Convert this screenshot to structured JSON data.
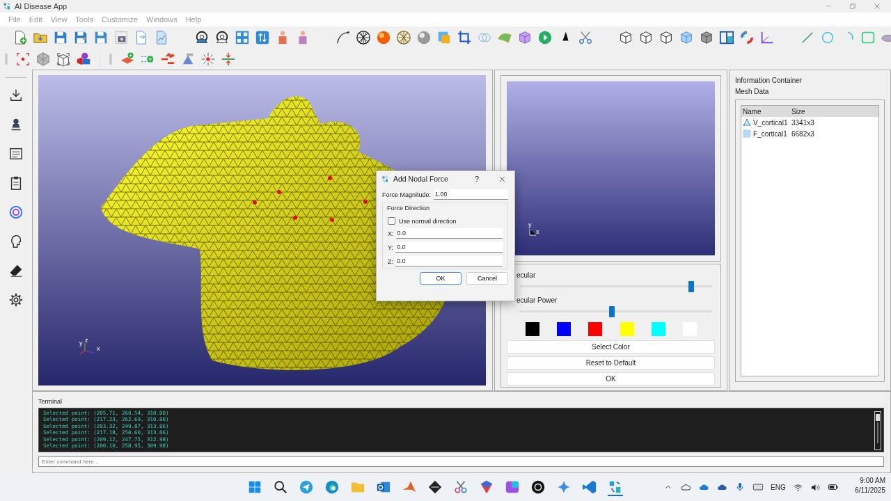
{
  "window": {
    "title": "AI Disease App"
  },
  "menu": [
    "File",
    "Edit",
    "View",
    "Tools",
    "Customize",
    "Windows",
    "Help"
  ],
  "viewport": {
    "axis_labels": [
      "y",
      "z",
      "x"
    ]
  },
  "preview": {
    "axis_labels": [
      "y",
      "x"
    ]
  },
  "lighting": {
    "sliders": [
      {
        "label": "ecular",
        "level": 0.89
      },
      {
        "label": "ecular Power",
        "level": 0.48
      }
    ],
    "swatches": [
      {
        "color": "#000000"
      },
      {
        "color": "#0000ff"
      },
      {
        "color": "#ff0000"
      },
      {
        "color": "#ffff00"
      },
      {
        "color": "#00ffff"
      },
      {
        "color": "#ffffff"
      }
    ],
    "buttons": [
      "Select Color",
      "Reset to Default",
      "OK"
    ]
  },
  "info": {
    "title": "Information Container",
    "section": "Mesh Data",
    "columns": [
      "Name",
      "Size"
    ],
    "rows": [
      {
        "kind": "vertices",
        "name": "V_cortical1",
        "size": "3341x3"
      },
      {
        "kind": "faces",
        "name": "F_cortical1",
        "size": "6682x3"
      }
    ]
  },
  "terminal": {
    "title": "Terminal",
    "lines": [
      "Selected point: (205.71, 260.54, 310.00)",
      "Selected point: (217.23, 262.69, 310.00)",
      "Selected point: (203.32, 249.87, 313.06)",
      "Selected point: (217.18, 250.60, 313.06)",
      "Selected point: (209.12, 247.75, 312.98)",
      "Selected point: (200.10, 258.95, 309.98)"
    ],
    "command_placeholder": "Enter command here..."
  },
  "dialog": {
    "title": "Add Nodal Force",
    "help": "?",
    "magnitude_label": "Force Magnitude:",
    "magnitude_value": "1.00",
    "group_title": "Force Direction",
    "normal_checkbox": {
      "label": "Use normal direction",
      "checked": false
    },
    "axes": [
      {
        "label": "X:",
        "value": "0.0"
      },
      {
        "label": "Y:",
        "value": "0.0"
      },
      {
        "label": "Z:",
        "value": "0.0"
      }
    ],
    "buttons": [
      "OK",
      "Cancel"
    ]
  },
  "taskbar": {
    "language": "ENG",
    "time": "9:00 AM",
    "date": "6/11/2025"
  }
}
